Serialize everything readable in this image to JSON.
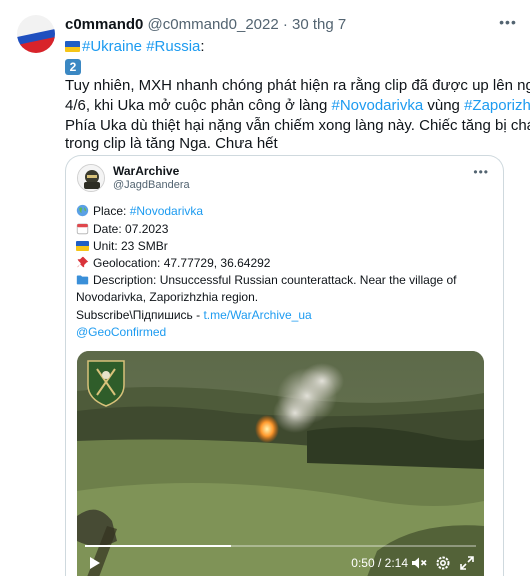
{
  "tweet": {
    "display_name": "c0mmand0",
    "handle": "@c0mmand0_2022",
    "separator": "·",
    "timestamp": "30 thg 7",
    "hashtag_ukraine": "#Ukraine",
    "hashtag_russia": "#Russia",
    "colon": ":",
    "number_emoji": "2",
    "body_line1": "Tuy nhiên, MXH nhanh chóng phát hiện ra rằng clip đã được up lên ngày",
    "body_line2_a": "4/6, khi Uka mở cuộc phản công ở làng ",
    "body_line2_link1": "#Novodarivka",
    "body_line2_b": " vùng ",
    "body_line2_link2": "#Zaporizhia",
    "body_line2_c": ".",
    "body_line3": "Phía Uka dù thiệt hại nặng vẫn chiếm xong làng này. Chiếc tăng bị cháy",
    "body_line4": "trong clip là tăng Nga. Chưa hết"
  },
  "quoted": {
    "display_name": "WarArchive",
    "handle": "@JagdBandera",
    "place_label": "Place: ",
    "place_link": "#Novodarivka",
    "date": "Date: 07.2023",
    "unit": "Unit: 23 SMBr",
    "geolocation": "Geolocation: 47.77729, 36.64292",
    "description_line1": "Description: Unsuccessful Russian counterattack. Near the village of",
    "description_line2": "Novodarivka, Zaporizhzhia region.",
    "subscribe_label": "Subscribe\\Підпишись - ",
    "subscribe_link": "t.me/WarArchive_ua",
    "geoconfirmed": "@GeoConfirmed"
  },
  "video": {
    "time": "0:50 / 2:14",
    "progress_fraction": 0.373
  },
  "icons": {
    "more": "more-icon",
    "globe": "globe-icon",
    "calendar": "calendar-icon",
    "flag": "ukraine-flag-icon",
    "pin": "pushpin-icon",
    "folder": "folder-icon",
    "play": "play-icon",
    "volume": "volume-muted-icon",
    "settings": "gear-icon",
    "fullscreen": "fullscreen-icon"
  },
  "colors": {
    "link": "#1d9bf0",
    "text": "#0f1419",
    "muted": "#536471",
    "border": "#cfd9de"
  }
}
